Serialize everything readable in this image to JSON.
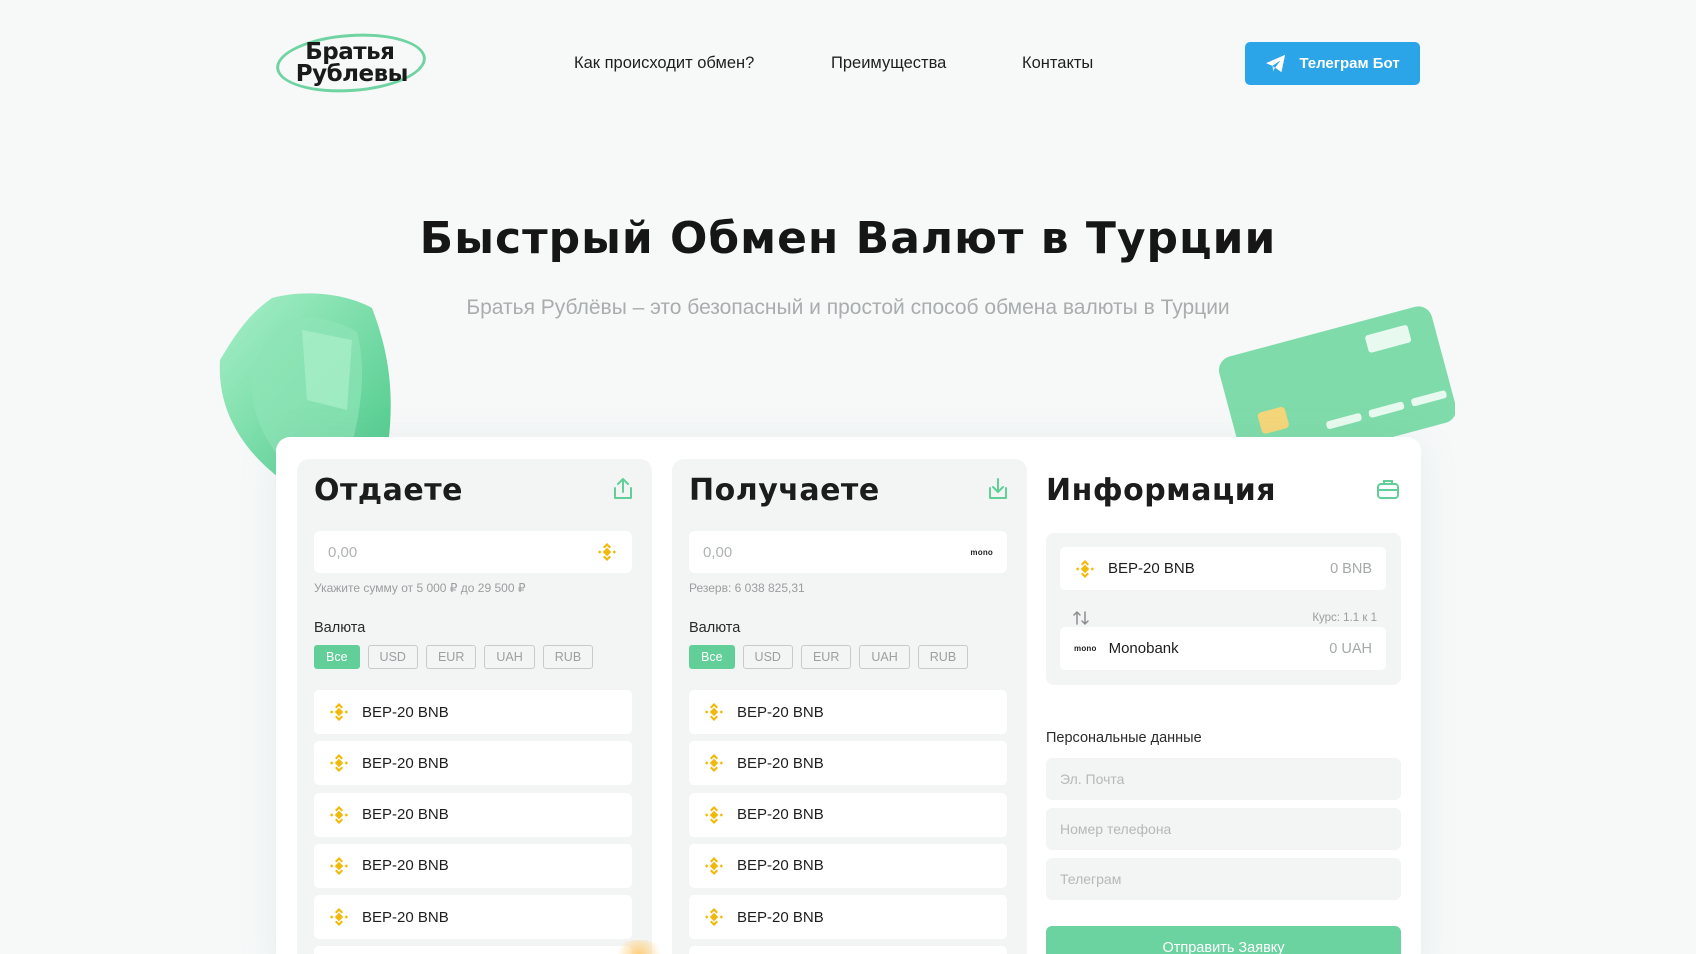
{
  "brand": {
    "logo_line1": "Братья",
    "logo_line2": "Рублевы"
  },
  "nav": {
    "items": [
      "Как происходит обмен?",
      "Преимущества",
      "Контакты"
    ],
    "telegram_button": "Телеграм Бот"
  },
  "hero": {
    "title": "Быстрый Обмен Валют в Турции",
    "subtitle": "Братья Рублёвы – это безопасный и простой способ обмена валюты в Турции"
  },
  "give": {
    "title": "Отдаете",
    "amount_placeholder": "0,00",
    "hint": "Укажите сумму от 5 000 ₽ до 29 500 ₽",
    "currency_label": "Валюта",
    "filters": [
      "Все",
      "USD",
      "EUR",
      "UAH",
      "RUB"
    ],
    "active_filter": "Все",
    "items": [
      "BEP-20 BNB",
      "BEP-20 BNB",
      "BEP-20 BNB",
      "BEP-20 BNB",
      "BEP-20 BNB"
    ]
  },
  "receive": {
    "title": "Получаете",
    "amount_placeholder": "0,00",
    "bank_badge": "mono",
    "hint": "Резерв: 6 038 825,31",
    "currency_label": "Валюта",
    "filters": [
      "Все",
      "USD",
      "EUR",
      "UAH",
      "RUB"
    ],
    "active_filter": "Все",
    "items": [
      "BEP-20 BNB",
      "BEP-20 BNB",
      "BEP-20 BNB",
      "BEP-20 BNB",
      "BEP-20 BNB"
    ]
  },
  "info": {
    "title": "Информация",
    "from": {
      "name": "BEP-20 BNB",
      "value": "0 BNB"
    },
    "rate": "Курс: 1.1 к 1",
    "to": {
      "badge": "mono",
      "name": "Monobank",
      "value": "0 UAH"
    },
    "personal_label": "Персональные данные",
    "email_placeholder": "Эл. Почта",
    "phone_placeholder": "Номер телефона",
    "telegram_placeholder": "Телеграм",
    "submit": "Отправить Заявку"
  },
  "colors": {
    "accent_green": "#63cf98",
    "telegram_blue": "#2ba5e8",
    "bnb_yellow": "#f0b90b",
    "background": "#f7f9f9"
  },
  "icons": [
    "telegram-icon",
    "upload-icon",
    "download-icon",
    "briefcase-icon",
    "bnb-icon",
    "swap-icon"
  ]
}
